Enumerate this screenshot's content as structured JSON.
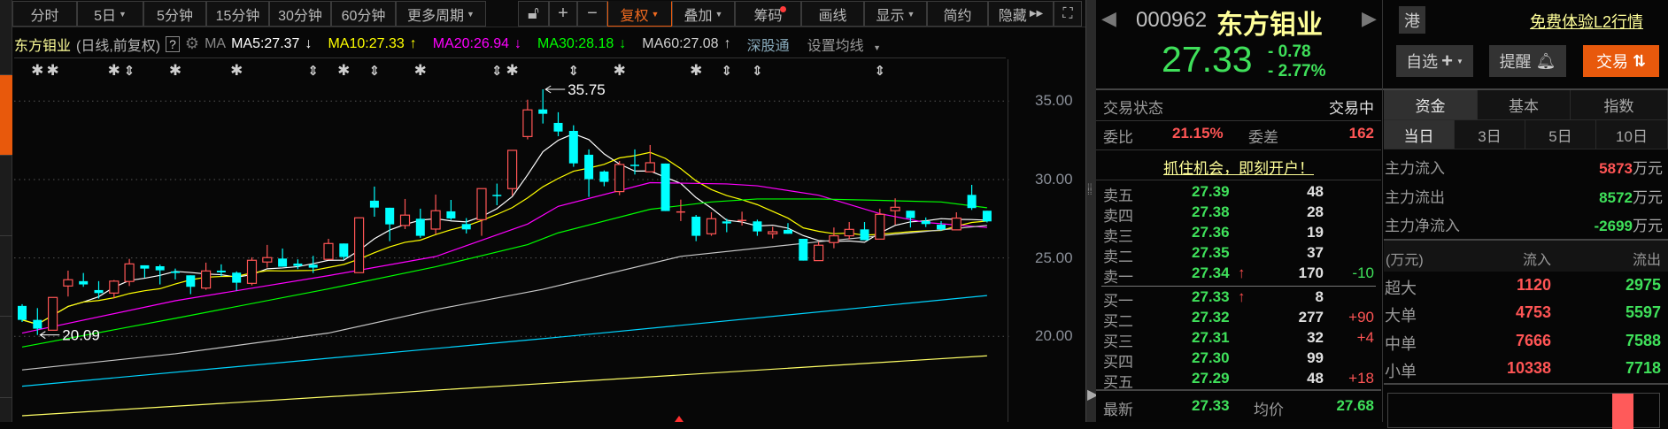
{
  "toolbar": {
    "periods": [
      {
        "label": "分时"
      },
      {
        "label": "5日",
        "dropdown": true
      },
      {
        "label": "5分钟"
      },
      {
        "label": "15分钟"
      },
      {
        "label": "30分钟"
      },
      {
        "label": "60分钟"
      },
      {
        "label": "更多周期",
        "dropdown": true
      }
    ],
    "tools": [
      {
        "label": "复权",
        "dropdown": true,
        "active": true
      },
      {
        "label": "叠加",
        "dropdown": true
      },
      {
        "label": "筹码",
        "badge_dot": true
      },
      {
        "label": "画线"
      },
      {
        "label": "显示",
        "dropdown": true
      },
      {
        "label": "简约"
      },
      {
        "label": "隐藏"
      }
    ],
    "icons": [
      "lock-icon",
      "zoom-in-icon",
      "zoom-out-icon",
      "fullscreen-icon"
    ]
  },
  "legend": {
    "stock_name": "东方钼业",
    "chart_mode": "(日线,前复权)",
    "help": "?",
    "ma_label": "MA",
    "ma": [
      {
        "text": "MA5:27.37",
        "arrow": "↓",
        "color": "#ffffff"
      },
      {
        "text": "MA10:27.33",
        "arrow": "↑",
        "color": "#ffff00"
      },
      {
        "text": "MA20:26.94",
        "arrow": "↓",
        "color": "#ff00ff"
      },
      {
        "text": "MA30:28.18",
        "arrow": "↓",
        "color": "#00ff00"
      },
      {
        "text": "MA60:27.08",
        "arrow": "↑",
        "color": "#d0d0d0"
      }
    ],
    "connect": "深股通",
    "settings": "设置均线"
  },
  "chart_data": {
    "type": "candlestick",
    "ylim": [
      14.6,
      37.8
    ],
    "yticks": [
      "35.00",
      "30.00",
      "25.00",
      "20.00"
    ],
    "ytick_values": [
      35,
      30,
      25,
      20
    ],
    "grid": true,
    "colors": {
      "up": "#ff5555",
      "down": "#00ffff"
    },
    "annotations": [
      {
        "label": "35.75",
        "index": 34,
        "value": 35.75,
        "kind": "high"
      },
      {
        "label": "20.09",
        "index": 1,
        "value": 20.09,
        "kind": "low"
      }
    ],
    "candles": [
      [
        21.94,
        22.05,
        20.92,
        21.05
      ],
      [
        21.05,
        21.8,
        20.09,
        20.49
      ],
      [
        20.39,
        22.48,
        20.39,
        22.48
      ],
      [
        23.21,
        24.19,
        22.54,
        23.61
      ],
      [
        23.52,
        24.04,
        23.16,
        23.31
      ],
      [
        22.95,
        23.52,
        22.41,
        22.76
      ],
      [
        22.76,
        23.59,
        22.42,
        23.52
      ],
      [
        23.5,
        24.94,
        23.21,
        24.62
      ],
      [
        24.53,
        24.53,
        23.74,
        24.32
      ],
      [
        24.47,
        24.57,
        23.31,
        24.21
      ],
      [
        24.14,
        24.32,
        23.63,
        24.04
      ],
      [
        23.89,
        23.89,
        22.69,
        23.16
      ],
      [
        23.08,
        24.7,
        22.97,
        24.17
      ],
      [
        24.19,
        24.59,
        23.82,
        24.08
      ],
      [
        24.06,
        24.14,
        22.91,
        23.42
      ],
      [
        23.38,
        25.04,
        23.25,
        24.85
      ],
      [
        24.74,
        25.83,
        24.38,
        25.02
      ],
      [
        24.96,
        25.6,
        24.44,
        24.44
      ],
      [
        24.64,
        24.91,
        24.29,
        24.49
      ],
      [
        24.57,
        25.13,
        24.04,
        24.38
      ],
      [
        24.91,
        26.22,
        24.91,
        25.92
      ],
      [
        25.92,
        25.92,
        24.91,
        25.06
      ],
      [
        24.06,
        27.56,
        24.06,
        27.56
      ],
      [
        28.65,
        29.55,
        27.63,
        28.21
      ],
      [
        28.2,
        28.2,
        26.07,
        27.14
      ],
      [
        27.07,
        28.76,
        26.84,
        27.73
      ],
      [
        27.5,
        28.14,
        26.28,
        26.41
      ],
      [
        26.84,
        29.04,
        26.52,
        28.01
      ],
      [
        27.97,
        28.7,
        27.42,
        27.52
      ],
      [
        27.16,
        27.54,
        26.56,
        26.82
      ],
      [
        27.44,
        29.42,
        26.41,
        29.42
      ],
      [
        28.98,
        29.74,
        28.36,
        28.95
      ],
      [
        29.42,
        31.86,
        28.98,
        31.86
      ],
      [
        32.74,
        35.09,
        32.56,
        34.44
      ],
      [
        34.47,
        35.75,
        33.57,
        34.19
      ],
      [
        33.61,
        34.29,
        32.76,
        33.06
      ],
      [
        33.1,
        33.46,
        30.81,
        31.03
      ],
      [
        31.58,
        31.92,
        28.89,
        30.02
      ],
      [
        30.51,
        30.58,
        29.57,
        29.85
      ],
      [
        29.23,
        31.18,
        29.0,
        30.96
      ],
      [
        30.9,
        31.92,
        30.32,
        30.83
      ],
      [
        30.49,
        32.2,
        30.49,
        31.07
      ],
      [
        31.02,
        31.02,
        27.99,
        27.99
      ],
      [
        27.91,
        28.72,
        27.35,
        27.93
      ],
      [
        27.63,
        27.74,
        26.07,
        26.41
      ],
      [
        26.54,
        27.91,
        26.41,
        27.5
      ],
      [
        27.33,
        27.5,
        26.64,
        27.2
      ],
      [
        27.35,
        27.95,
        27.07,
        27.39
      ],
      [
        27.33,
        27.44,
        26.41,
        26.69
      ],
      [
        26.54,
        26.99,
        26.24,
        26.67
      ],
      [
        26.79,
        27.22,
        26.54,
        26.54
      ],
      [
        26.22,
        26.22,
        24.83,
        24.83
      ],
      [
        24.83,
        26.03,
        24.83,
        25.81
      ],
      [
        25.98,
        26.94,
        25.62,
        26.41
      ],
      [
        26.41,
        27.29,
        26.18,
        26.82
      ],
      [
        26.82,
        27.29,
        26.13,
        26.13
      ],
      [
        26.2,
        28.14,
        26.2,
        27.78
      ],
      [
        28.01,
        28.8,
        27.12,
        28.23
      ],
      [
        28.01,
        28.01,
        26.94,
        27.54
      ],
      [
        27.35,
        27.58,
        26.97,
        27.16
      ],
      [
        27.12,
        27.35,
        26.73,
        26.82
      ],
      [
        26.79,
        27.91,
        26.79,
        27.54
      ],
      [
        29.02,
        29.66,
        28.06,
        28.18
      ],
      [
        28.01,
        28.01,
        27.26,
        27.33
      ]
    ],
    "candle_fields": [
      "open",
      "high",
      "low",
      "close"
    ],
    "series": [
      {
        "name": "MA5",
        "color": "#ffffff",
        "window": 5
      },
      {
        "name": "MA10",
        "color": "#ffff00",
        "window": 10
      },
      {
        "name": "MA20",
        "color": "#ff00ff",
        "points": [
          [
            0,
            20.21
          ],
          [
            10,
            22.27
          ],
          [
            20,
            23.87
          ],
          [
            27,
            25.09
          ],
          [
            33,
            27.16
          ],
          [
            35,
            28.29
          ],
          [
            41,
            29.8
          ],
          [
            46,
            29.72
          ],
          [
            48,
            29.6
          ],
          [
            52,
            29.0
          ],
          [
            56,
            27.82
          ],
          [
            59,
            27.26
          ],
          [
            63,
            26.94
          ]
        ]
      },
      {
        "name": "MA30",
        "color": "#00ff00",
        "points": [
          [
            0,
            19.32
          ],
          [
            10,
            21.15
          ],
          [
            20,
            23.03
          ],
          [
            27,
            24.44
          ],
          [
            33,
            25.85
          ],
          [
            35,
            26.6
          ],
          [
            41,
            28.1
          ],
          [
            45,
            28.57
          ],
          [
            48,
            28.76
          ],
          [
            52,
            28.76
          ],
          [
            56,
            28.67
          ],
          [
            60,
            28.57
          ],
          [
            63,
            28.2
          ]
        ]
      },
      {
        "name": "MA60",
        "color": "#c8c8c8",
        "points": [
          [
            0,
            17.86
          ],
          [
            10,
            18.89
          ],
          [
            20,
            20.21
          ],
          [
            27,
            21.71
          ],
          [
            34,
            23.0
          ],
          [
            43,
            25.1
          ],
          [
            52,
            26.03
          ],
          [
            63,
            27.07
          ]
        ]
      },
      {
        "color": "#00d4ff",
        "points": [
          [
            0,
            16.82
          ],
          [
            34,
            19.85
          ],
          [
            63,
            22.6
          ]
        ]
      },
      {
        "color": "#ffff66",
        "points": [
          [
            0,
            14.94
          ],
          [
            35,
            17.05
          ],
          [
            63,
            18.76
          ]
        ]
      }
    ],
    "signal_markers": [
      {
        "index": 1,
        "type": "star"
      },
      {
        "index": 2,
        "type": "star"
      },
      {
        "index": 6,
        "type": "star"
      },
      {
        "index": 7,
        "type": "updown"
      },
      {
        "index": 10,
        "type": "star"
      },
      {
        "index": 14,
        "type": "star"
      },
      {
        "index": 19,
        "type": "updown"
      },
      {
        "index": 21,
        "type": "star"
      },
      {
        "index": 23,
        "type": "updown"
      },
      {
        "index": 26,
        "type": "star"
      },
      {
        "index": 31,
        "type": "updown"
      },
      {
        "index": 32,
        "type": "star"
      },
      {
        "index": 36,
        "type": "updown"
      },
      {
        "index": 39,
        "type": "star"
      },
      {
        "index": 44,
        "type": "star"
      },
      {
        "index": 46,
        "type": "updown"
      },
      {
        "index": 48,
        "type": "updown"
      },
      {
        "index": 56,
        "type": "updown"
      }
    ]
  },
  "header": {
    "code": "000962",
    "name": "东方钼业",
    "hk_badge": "港",
    "l2_link": "免费体验L2行情",
    "price": "27.33",
    "change": "- 0.78",
    "change_pct": "- 2.77%",
    "watch_btn": "自选",
    "alert_btn": "提醒",
    "trade_btn": "交易"
  },
  "quote": {
    "status_label": "交易状态",
    "status_value": "交易中",
    "ratio_label": "委比",
    "ratio_value": "21.15%",
    "diff_label": "委差",
    "diff_value": "162",
    "open_account": "抓住机会，即刻开户！",
    "asks": [
      {
        "label": "卖五",
        "price": "27.39",
        "vol": "48",
        "chg": ""
      },
      {
        "label": "卖四",
        "price": "27.38",
        "vol": "28",
        "chg": ""
      },
      {
        "label": "卖三",
        "price": "27.36",
        "vol": "19",
        "chg": ""
      },
      {
        "label": "卖二",
        "price": "27.35",
        "vol": "37",
        "chg": ""
      },
      {
        "label": "卖一",
        "price": "27.34",
        "arrow": "🠉",
        "vol": "170",
        "chg": "-10"
      }
    ],
    "bids": [
      {
        "label": "买一",
        "price": "27.33",
        "arrow": "🠉",
        "vol": "8",
        "chg": ""
      },
      {
        "label": "买二",
        "price": "27.32",
        "vol": "277",
        "chg": "+90"
      },
      {
        "label": "买三",
        "price": "27.31",
        "vol": "32",
        "chg": "+4"
      },
      {
        "label": "买四",
        "price": "27.30",
        "vol": "99",
        "chg": ""
      },
      {
        "label": "买五",
        "price": "27.29",
        "vol": "48",
        "chg": "+18"
      }
    ],
    "last_label": "最新",
    "last_value": "27.33",
    "avg_label": "均价",
    "avg_value": "27.68"
  },
  "funds": {
    "tabs": [
      "资金",
      "基本",
      "指数"
    ],
    "periods": [
      "当日",
      "3日",
      "5日",
      "10日"
    ],
    "main": [
      {
        "label": "主力流入",
        "value": "5873",
        "unit": "万元",
        "color": "red"
      },
      {
        "label": "主力流出",
        "value": "8572",
        "unit": "万元",
        "color": "green"
      },
      {
        "label": "主力净流入",
        "value": "-2699",
        "unit": "万元",
        "color": "green"
      }
    ],
    "table_header": [
      "(万元)",
      "流入",
      "流出"
    ],
    "rows": [
      {
        "label": "超大",
        "in": "1120",
        "out": "2975"
      },
      {
        "label": "大单",
        "in": "4753",
        "out": "5597"
      },
      {
        "label": "中单",
        "in": "7666",
        "out": "7588"
      },
      {
        "label": "小单",
        "in": "10338",
        "out": "7718"
      }
    ]
  }
}
